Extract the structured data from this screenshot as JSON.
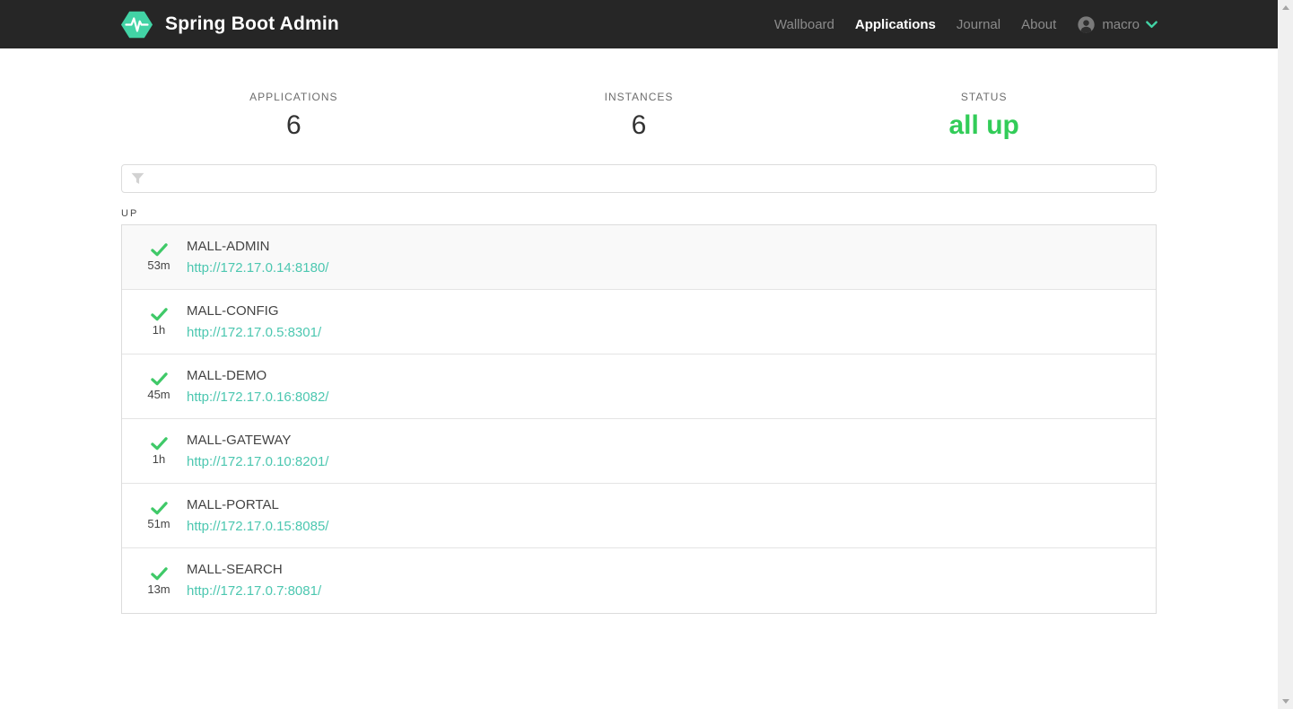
{
  "navbar": {
    "brand": "Spring Boot Admin",
    "items": [
      {
        "label": "Wallboard",
        "active": false
      },
      {
        "label": "Applications",
        "active": true
      },
      {
        "label": "Journal",
        "active": false
      },
      {
        "label": "About",
        "active": false
      }
    ],
    "user": {
      "name": "macro"
    }
  },
  "stats": [
    {
      "label": "APPLICATIONS",
      "value": "6"
    },
    {
      "label": "INSTANCES",
      "value": "6"
    },
    {
      "label": "STATUS",
      "value": "all up"
    }
  ],
  "filter": {
    "value": "",
    "icon": "funnel-icon"
  },
  "group": {
    "label": "UP"
  },
  "applications": [
    {
      "name": "MALL-ADMIN",
      "uptime": "53m",
      "url": "http://172.17.0.14:8180/",
      "status": "up"
    },
    {
      "name": "MALL-CONFIG",
      "uptime": "1h",
      "url": "http://172.17.0.5:8301/",
      "status": "up"
    },
    {
      "name": "MALL-DEMO",
      "uptime": "45m",
      "url": "http://172.17.0.16:8082/",
      "status": "up"
    },
    {
      "name": "MALL-GATEWAY",
      "uptime": "1h",
      "url": "http://172.17.0.10:8201/",
      "status": "up"
    },
    {
      "name": "MALL-PORTAL",
      "uptime": "51m",
      "url": "http://172.17.0.15:8085/",
      "status": "up"
    },
    {
      "name": "MALL-SEARCH",
      "uptime": "13m",
      "url": "http://172.17.0.7:8081/",
      "status": "up"
    }
  ],
  "icons": {
    "logo": "heartbeat-hexagon",
    "status_up": "check-mark",
    "user": "person-avatar",
    "user_caret": "chevron-down",
    "filter": "funnel"
  },
  "colors": {
    "navbar_bg": "#262626",
    "accent_teal": "#42d3a5",
    "link_teal": "#4cc7b0",
    "status_green": "#32cc58",
    "check_green": "#3fc968",
    "nav_inactive": "#8b8b8b"
  }
}
